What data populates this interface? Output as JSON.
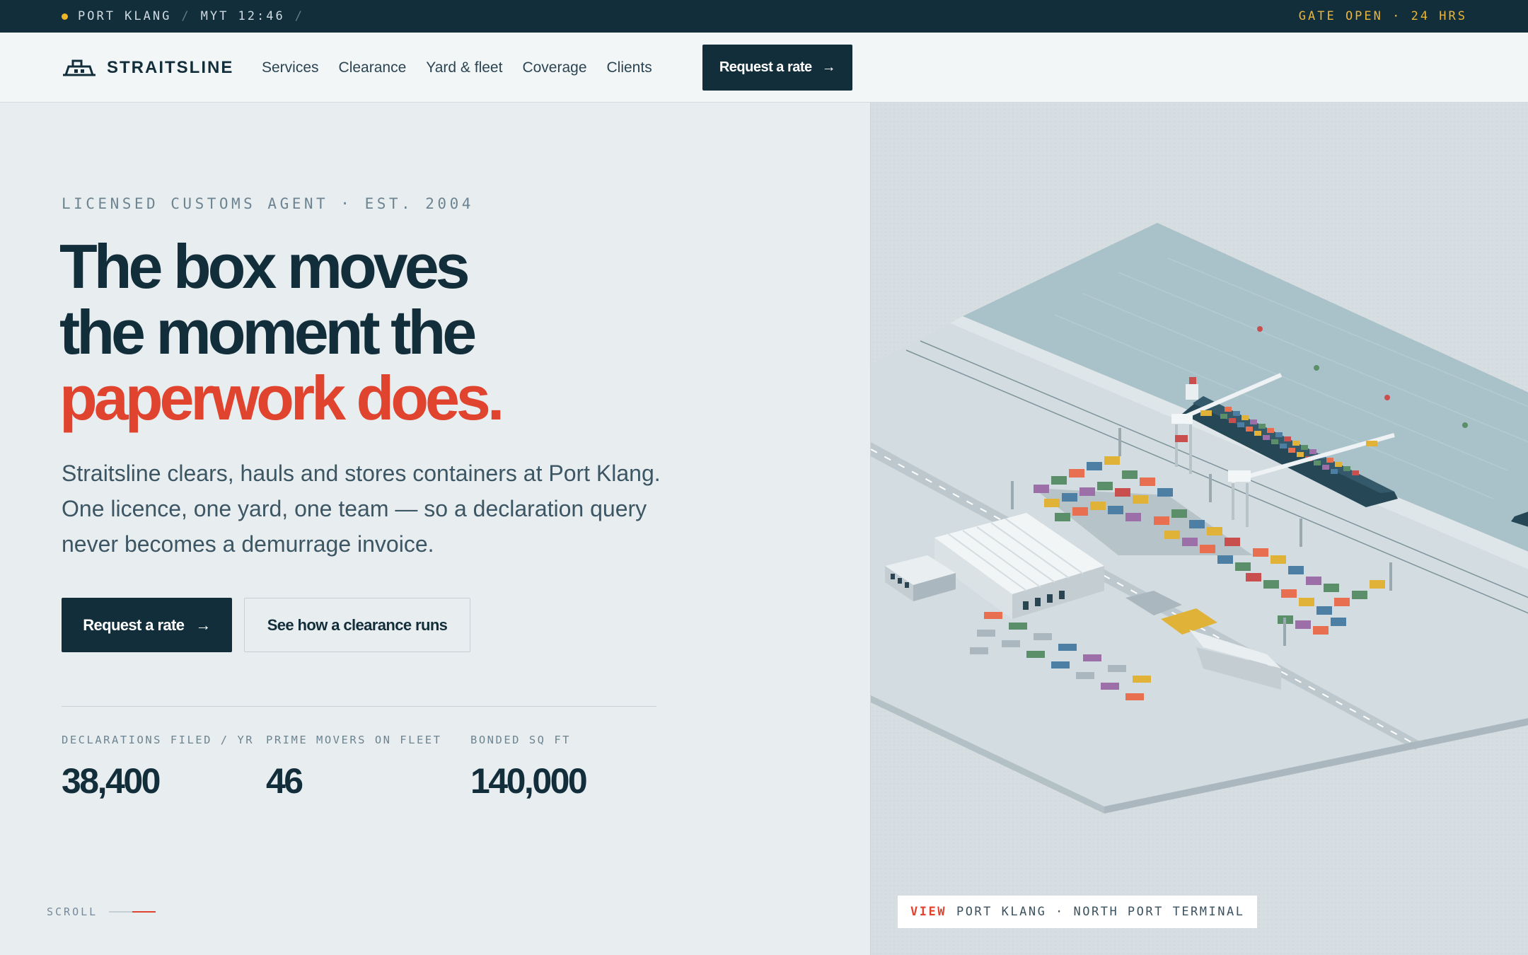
{
  "topbar": {
    "location": "PORT KLANG",
    "time": "MYT 12:46",
    "status": "GATE OPEN · 24 HRS",
    "status_dot_color": "#f0b429"
  },
  "nav": {
    "brand": "STRAITSLINE",
    "brand_icon": "terminal-logo-icon",
    "links": [
      "Services",
      "Clearance",
      "Yard & fleet",
      "Coverage",
      "Clients"
    ],
    "cta_label": "Request a rate",
    "cta_arrow": "→"
  },
  "hero": {
    "eyebrow": "LICENSED CUSTOMS AGENT · EST. 2004",
    "headline_line1": "The box moves",
    "headline_line2": "the moment the",
    "headline_accent": "paperwork does.",
    "lede": "Straitsline clears, hauls and stores containers at Port Klang. One licence, one yard, one team — so a declaration query never becomes a demurrage invoice.",
    "primary_label": "Request a rate",
    "primary_arrow": "→",
    "secondary_label": "See how a clearance runs",
    "accent_color": "#e0432e"
  },
  "stats": [
    {
      "label": "DECLARATIONS FILED / YR",
      "value": "38,400"
    },
    {
      "label": "PRIME MOVERS ON FLEET",
      "value": "46"
    },
    {
      "label": "BONDED SQ FT",
      "value": "140,000"
    }
  ],
  "scroll_label": "SCROLL",
  "visual": {
    "caption_tag": "VIEW",
    "caption_text": "PORT KLANG · NORTH PORT TERMINAL"
  },
  "colors": {
    "navy": "#132e3b",
    "accent_red": "#e0432e",
    "amber": "#e9b53a",
    "background": "#e8edf0"
  }
}
